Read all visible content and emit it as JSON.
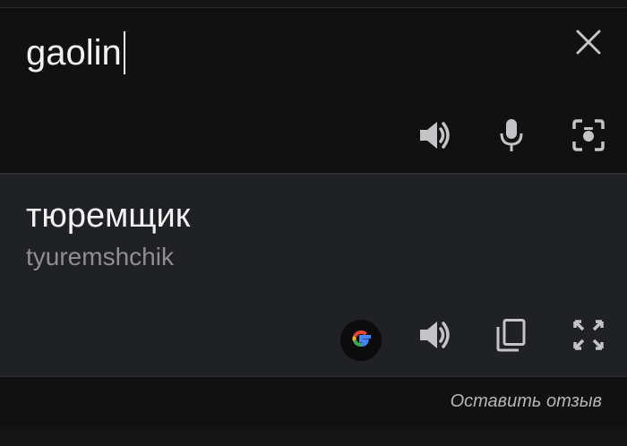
{
  "input": {
    "text": "gaolin"
  },
  "output": {
    "translation": "тюремщик",
    "transliteration": "tyuremshchik"
  },
  "icons": {
    "clear": "close-icon",
    "speak_source": "speaker-icon",
    "mic": "microphone-icon",
    "camera": "camera-icon",
    "google": "google-logo-icon",
    "speak_translation": "speaker-icon",
    "copy": "copy-icon",
    "fullscreen": "fullscreen-icon"
  },
  "footer": {
    "feedback_label": "Оставить отзыв"
  },
  "colors": {
    "background": "#111112",
    "output_background": "#202124",
    "text_primary": "#f2f2f2",
    "text_secondary": "#8e8e93",
    "icon": "#c4c4c7"
  }
}
